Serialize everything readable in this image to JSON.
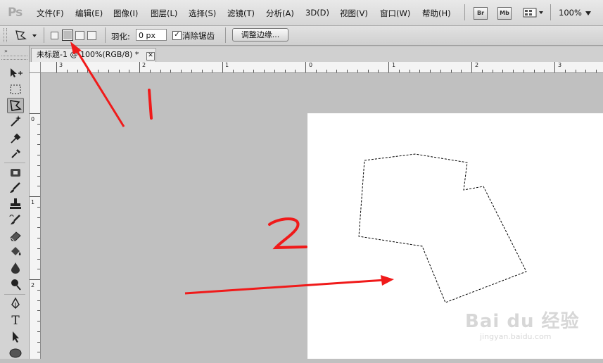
{
  "app": {
    "logo": "Ps"
  },
  "menubar": {
    "items": [
      "文件(F)",
      "编辑(E)",
      "图像(I)",
      "图层(L)",
      "选择(S)",
      "滤镜(T)",
      "分析(A)",
      "3D(D)",
      "视图(V)",
      "窗口(W)",
      "帮助(H)"
    ],
    "bridge_label": "Br",
    "minibridge_label": "Mb",
    "zoom": "100%"
  },
  "options": {
    "feather_label": "羽化:",
    "feather_value": "0 px",
    "antialias_label": "消除锯齿",
    "antialias_checked": "✓",
    "refine_edge_button": "调整边缘..."
  },
  "document": {
    "tab_title": "未标题-1 @ 100%(RGB/8) *",
    "close_glyph": "✕"
  },
  "rulers": {
    "horizontal_labels": [
      "3",
      "2",
      "1",
      "0",
      "1",
      "2",
      "3"
    ],
    "vertical_labels": [
      "0",
      "1",
      "2"
    ]
  },
  "annotations": {
    "label_1": "1",
    "label_2": "2",
    "color": "#f01a1a"
  },
  "watermark": {
    "brand": "Bai du 经验",
    "url": "jingyan.baidu.com"
  }
}
